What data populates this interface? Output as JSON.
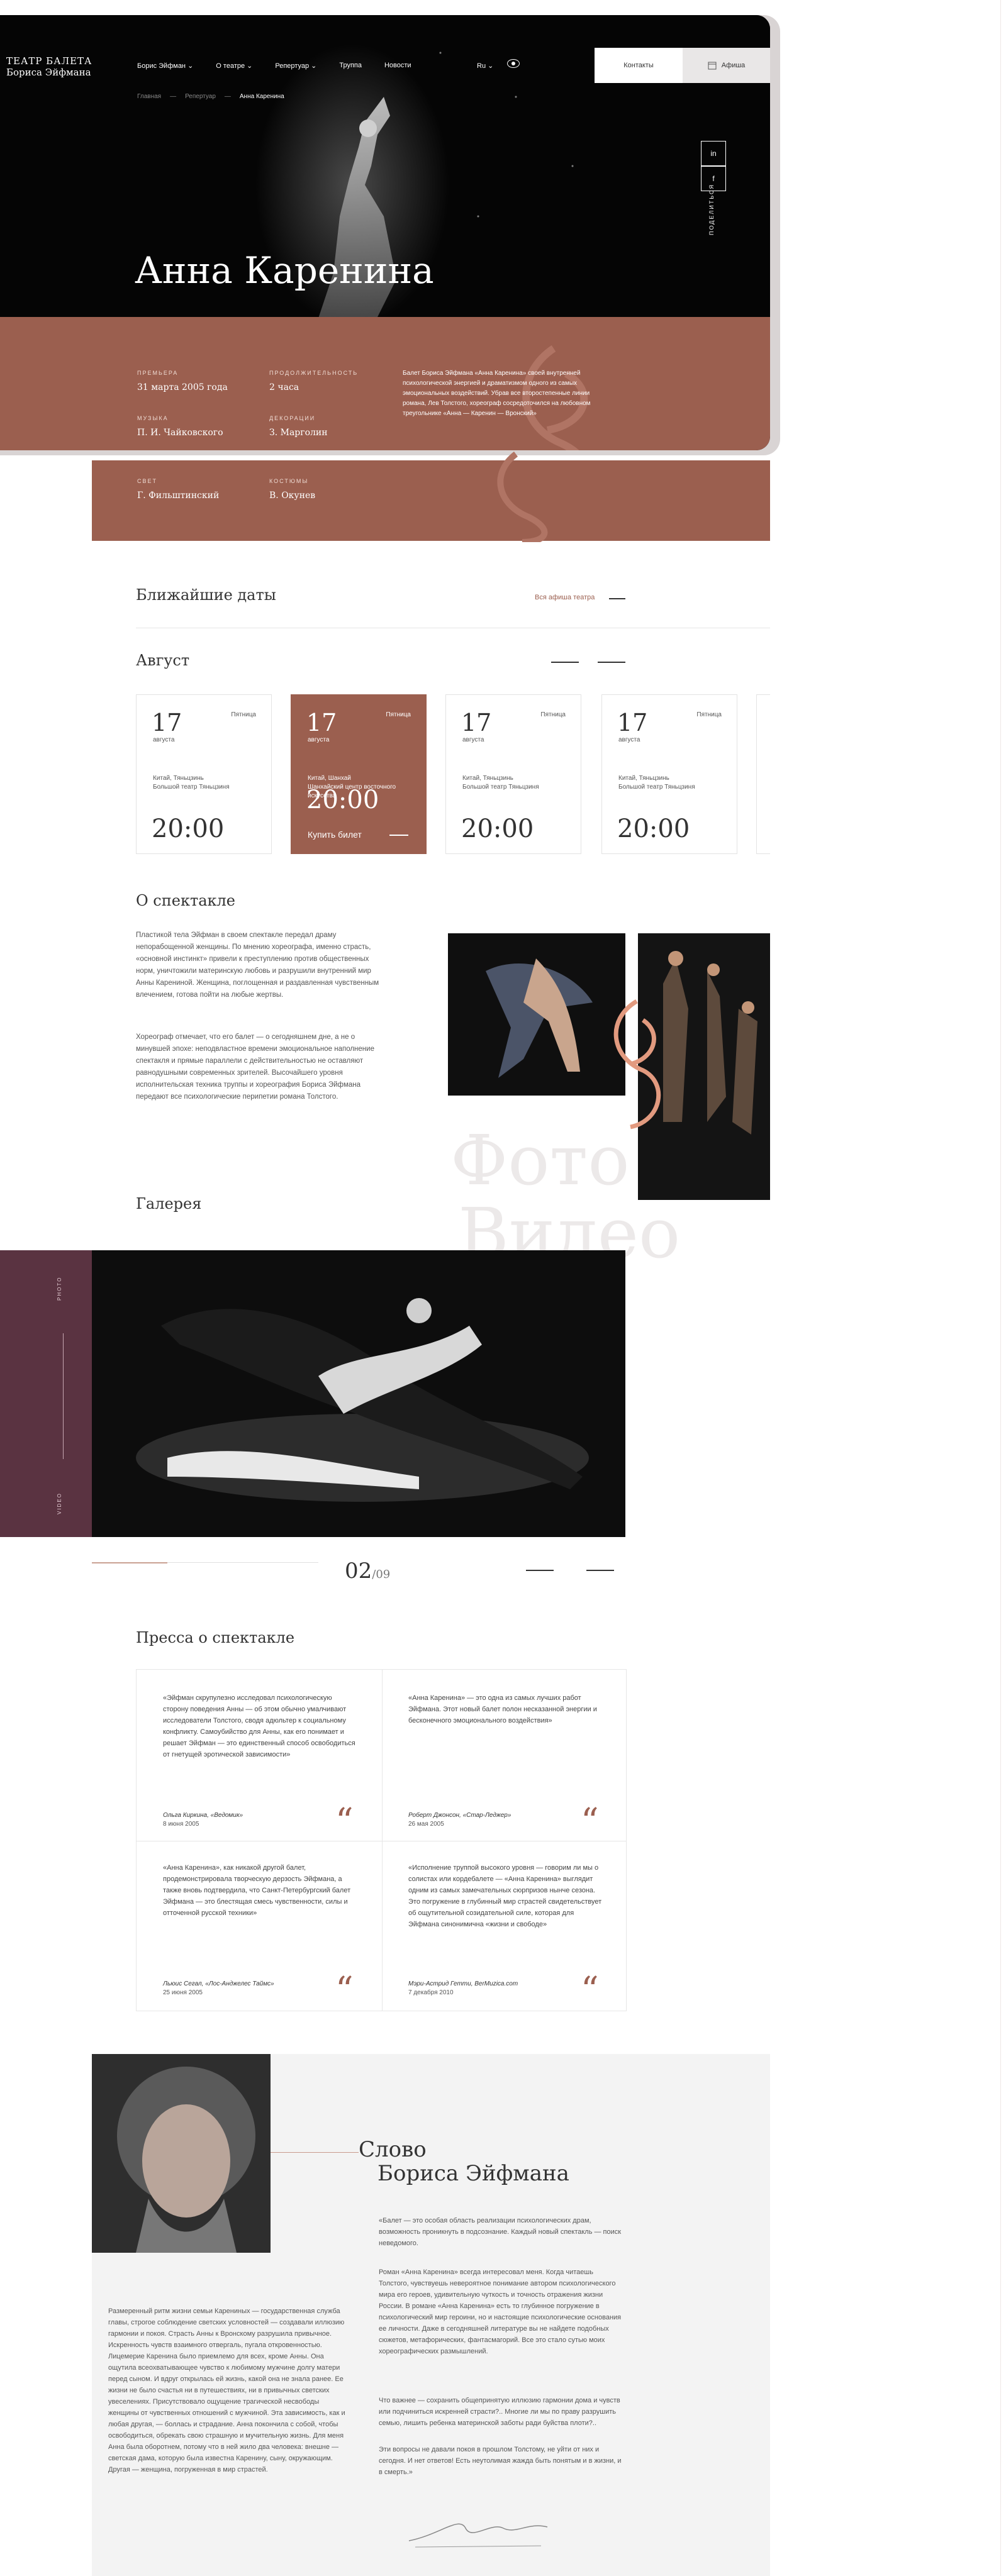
{
  "header": {
    "logo_line1": "ТЕАТР БАЛЕТА",
    "logo_line2": "Бориса Эйфмана",
    "nav": [
      "Борис Эйфман ⌄",
      "О театре ⌄",
      "Репертуар ⌄",
      "Труппа",
      "Новости"
    ],
    "lang": "Ru ⌄",
    "contacts": "Контакты",
    "tickets": "Афиша"
  },
  "breadcrumbs": [
    "Главная",
    "—",
    "Репертуар",
    "—",
    "Анна Каренина"
  ],
  "social": [
    "in",
    "f"
  ],
  "share": "ПОДЕЛИТЬСЯ",
  "title": "Анна Каренина",
  "info": {
    "premiere_label": "Премьера",
    "premiere": "31 марта 2005 года",
    "duration_label": "Продолжительность",
    "duration": "2 часа",
    "music_label": "Музыка",
    "music": "П. И. Чайковского",
    "decor_label": "Декорации",
    "decor": "З. Марголин",
    "light_label": "Свет",
    "light": "Г. Фильштинский",
    "costume_label": "Костюмы",
    "costume": "В. Окунев",
    "description": "Балет Бориса Эйфмана «Анна Каренина» своей внутренней психологической энергией и драматизмом одного из самых эмоциональных воздействий. Убрав все второстепенные линии романа, Лев Толстого, хореограф сосредоточился на любовном треугольнике «Анна — Каренин — Вронский»"
  },
  "dates": {
    "heading": "Ближайшие даты",
    "all_link": "Вся афиша театра",
    "month": "Август",
    "cards": [
      {
        "day": "17",
        "month": "августа",
        "weekday": "Пятница",
        "place": "Китай, Тяньцзинь\nБольшой театр Тяньцзиня",
        "time": "20:00"
      },
      {
        "day": "17",
        "month": "августа",
        "weekday": "Пятница",
        "place": "Китай, Шанхай\nШанхайский центр восточного искусства",
        "time": "20:00",
        "buy": "Купить билет"
      },
      {
        "day": "17",
        "month": "августа",
        "weekday": "Пятница",
        "place": "Китай, Тяньцзинь\nБольшой театр Тяньцзиня",
        "time": "20:00"
      },
      {
        "day": "17",
        "month": "августа",
        "weekday": "Пятница",
        "place": "Китай, Тяньцзинь\nБольшой театр Тяньцзиня",
        "time": "20:00"
      }
    ]
  },
  "about": {
    "heading": "О спектакле",
    "p1": "Пластикой тела Эйфман в своем спектакле передал драму непорабощенной женщины. По мнению хореографа, именно страсть, «основной инстинкт» привели к преступлению против общественных норм, уничтожили материнскую любовь и разрушили внутренний мир Анны Карениной. Женщина, поглощенная и раздавленная чувственным влечением, готова пойти на любые жертвы.",
    "p2": "Хореограф отмечает, что его балет — о сегодняшнем дне, а не о минувшей эпохе: неподвластное времени эмоциональное наполнение спектакля и прямые параллели с действительностью не оставляют равнодушными современных зрителей. Высочайшего уровня исполнительская техника труппы и хореография Бориса Эйфмана передают все психологические перипетии романа Толстого.",
    "watermark1": "Фото",
    "watermark2": "Видео"
  },
  "gallery": {
    "heading": "Галерея",
    "side_photo": "PHOTO",
    "side_video": "VIDEO",
    "current": "02",
    "total": "/09"
  },
  "press": {
    "heading": "Пресса о спектакле",
    "items": [
      {
        "quote": "«Эйфман скрупулезно исследовал психологическую сторону поведения Анны — об этом обычно умалчивают исследователи Толстого, сводя адюльтер к социальному конфликту. Самоубийство для Анны, как его понимает и решает Эйфман — это единственный способ освободиться от гнетущей эротической зависимости»",
        "author": "Ольга Киркина, «Ведомик»",
        "date": "8 июня 2005"
      },
      {
        "quote": "«Анна Каренина» — это одна из самых лучших работ Эйфмана. Этот новый балет полон несказанной энергии и бесконечного эмоционального воздействия»",
        "author": "Роберт Джонсон, «Стар-Леджер»",
        "date": "26 мая 2005"
      },
      {
        "quote": "«Анна Каренина», как никакой другой балет, продемонстрировала творческую дерзость Эйфмана, а также вновь подтвердила, что Санкт-Петербургский балет Эйфмана — это блестящая смесь чувственности, силы и отточенной русской техники»",
        "author": "Льюис Сегал, «Лос-Анджелес Таймс»",
        "date": "25 июня 2005"
      },
      {
        "quote": "«Исполнение труппой высокого уровня — говорим ли мы о солистах или кордебалете — «Анна Каренина» выглядит одним из самых замечательных сюрпризов нынче сезона. Это погружение в глубинный мир страстей свидетельствует об ощутительной созидательной силе, которая для Эйфмана синонимична «жизни и свободе»",
        "author": "Мэри-Астрид Гетти, BerMuzica.com",
        "date": "7 декабря 2010"
      }
    ]
  },
  "word": {
    "title1": "Слово",
    "title2": "Бориса Эйфмана",
    "p_right1": "«Балет — это особая область реализации психологических драм, возможность проникнуть в подсознание. Каждый новый спектакль — поиск неведомого.",
    "p_right2": "Роман «Анна Каренина» всегда интересовал меня. Когда читаешь Толстого, чувствуешь невероятное понимание автором психологического мира его героев, удивительную чуткость и точность отражения жизни России. В романе «Анна Каренина» есть то глубинное погружение в психологический мир героини, но и настоящие психологические основания ее личности. Даже в сегодняшней литературе вы не найдете подобных сюжетов, метафорических, фантасмагорий. Все это стало сутью моих хореографических размышлений.",
    "p_right3": "Что важнее — сохранить общепринятую иллюзию гармонии дома и чувств или подчиниться искренней страсти?.. Многие ли мы по праву разрушить семью, лишить ребенка материнской заботы ради буйства плоти?..",
    "p_right4": "Эти вопросы не давали покоя в прошлом Толстому, не уйти от них и сегодня. И нет ответов! Есть неутолимая жажда быть понятым и в жизни, и в смерть.»",
    "p_left": "Размеренный ритм жизни семьи Карениных — государственная служба главы, строгое соблюдение светских условностей — создавали иллюзию гармонии и покоя. Страсть Анны к Вронскому разрушила привычное. Искренность чувств взаимного отвергаль, пугала откровенностью. Лицемерие Каренина было приемлемо для всех, кроме Анны. Она ощутила всеохватывающее чувство к любимому мужчине долгу матери перед сыном. И вдруг открылась ей жизнь, какой она не знала ранее. Ее жизни не было счастья ни в путешествиях, ни в привычных светских увеселениях. Присутствовало ощущение трагической несвободы женщины от чувственных отношений с мужчиной. Эта зависимость, как и любая другая, — боллась и страдание. Анна покончила с собой, чтобы освободиться, обрекать свою страшную и мучительную жизнь. Для меня Анна была оборотнем, потому что в ней жило два человека: внешне — светская дама, которую была известна Каренину, сыну, окружающим. Другая — женщина, погруженная в мир страстей.",
    "signature": "Борис Эйфман"
  }
}
